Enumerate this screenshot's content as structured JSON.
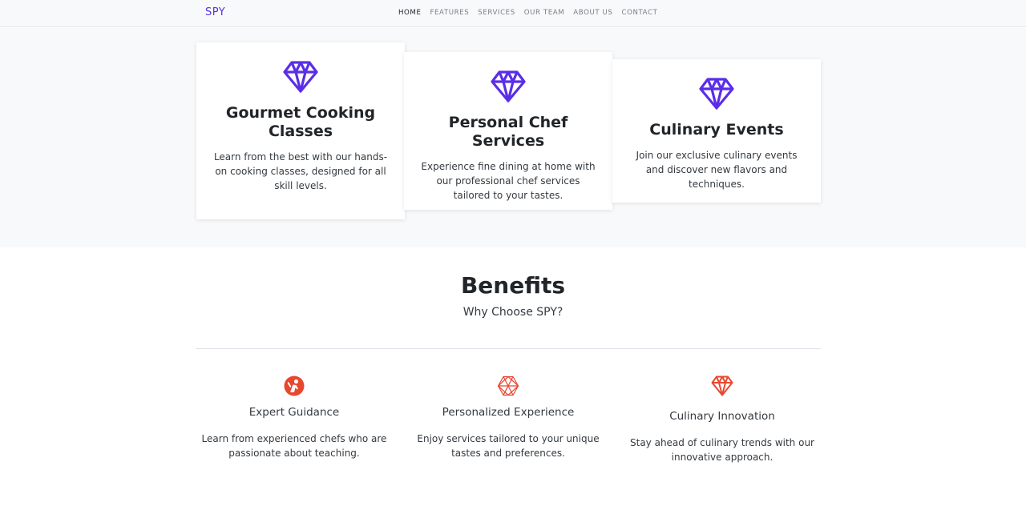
{
  "nav": {
    "brand": "SPY",
    "links": [
      "HOME",
      "FEATURES",
      "SERVICES",
      "OUR TEAM",
      "ABOUT US",
      "CONTACT"
    ]
  },
  "services": [
    {
      "icon": "diamond-icon",
      "title": "Gourmet Cooking Classes",
      "description": "Learn from the best with our hands-on cooking classes, designed for all skill levels."
    },
    {
      "icon": "diamond-icon",
      "title": "Personal Chef Services",
      "description": "Experience fine dining at home with our professional chef services tailored to your tastes."
    },
    {
      "icon": "diamond-icon",
      "title": "Culinary Events",
      "description": "Join our exclusive culinary events and discover new flavors and techniques."
    }
  ],
  "benefits": {
    "title": "Benefits",
    "subtitle": "Why Choose SPY?",
    "items": [
      {
        "icon": "chef-icon",
        "title": "Expert Guidance",
        "description": "Learn from experienced chefs who are passionate about teaching."
      },
      {
        "icon": "geometric-icon",
        "title": "Personalized Experience",
        "description": "Enjoy services tailored to your unique tastes and preferences."
      },
      {
        "icon": "diamond-icon",
        "title": "Culinary Innovation",
        "description": "Stay ahead of culinary trends with our innovative approach."
      }
    ]
  },
  "colors": {
    "accent": "#5a2ee8",
    "benefit_icon": "#e8472f",
    "hero_bg": "#f8f9fa"
  }
}
